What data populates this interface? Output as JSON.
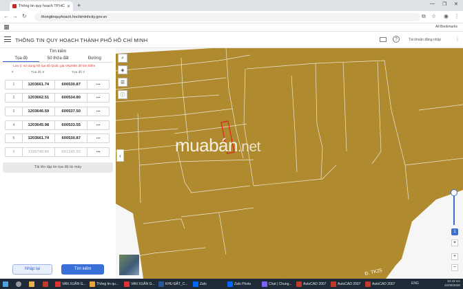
{
  "browser": {
    "tab_title": "Thông tin quy hoạch TP.HCM",
    "url": "thongtinquyhoach.hochiminhcity.gov.vn",
    "bookmarks_label": "All Bookmarks"
  },
  "header": {
    "title": "THÔNG TIN QUY HOẠCH THÀNH PHỐ HỒ CHÍ MINH",
    "login_label": "Tài khoản đăng nhập"
  },
  "panel": {
    "search_title": "Tìm kiếm",
    "tabs": [
      {
        "label": "Tọa độ"
      },
      {
        "label": "Số thửa đất"
      },
      {
        "label": "Đường"
      }
    ],
    "note": "Lưu ý: sử dụng hệ tọa độ Quốc gia VN2000 để tìm kiếm",
    "col_index": "#",
    "col_x": "Tọa độ X",
    "col_y": "Tọa độ Y",
    "rows": [
      {
        "idx": "1",
        "x": "1203661.74",
        "y": "600530.87",
        "more": "..."
      },
      {
        "idx": "2",
        "x": "1203662.51",
        "y": "600534.80",
        "more": "..."
      },
      {
        "idx": "3",
        "x": "1203646.59",
        "y": "600537.50",
        "more": "..."
      },
      {
        "idx": "4",
        "x": "1203645.98",
        "y": "600533.55",
        "more": "..."
      },
      {
        "idx": "5",
        "x": "1203661.74",
        "y": "600530.87",
        "more": "..."
      },
      {
        "idx": "6",
        "x": "1199748.84",
        "y": "651245.92",
        "more": "..."
      }
    ],
    "load_button": "Tải lên tập tin tọa độ từ máy",
    "import_button": "Nhập lại",
    "search_button": "Tìm kiếm"
  },
  "map": {
    "watermark_main": "muabán",
    "watermark_suffix": ".net",
    "road_label": "Đ. TK25",
    "zoom_level": "1",
    "parcel_fill": "#b08a2e",
    "highlight_color": "#e02020",
    "zoom_in_label": "+",
    "zoom_out_label": "−"
  },
  "taskbar": {
    "items": [
      {
        "label": "VAN XUÂN G...",
        "color": "#d33"
      },
      {
        "label": "Thông tin qu...",
        "color": "#e8a33a"
      },
      {
        "label": "VAN XUÂN G...",
        "color": "#d33"
      },
      {
        "label": "KHU ĐẤT_C...",
        "color": "#2b5797"
      },
      {
        "label": "Zalo",
        "color": "#0068ff"
      },
      {
        "label": "Zalo Photo",
        "color": "#0068ff"
      },
      {
        "label": "Chat | Chung...",
        "color": "#7b61ff"
      },
      {
        "label": "AutoCAD 2007",
        "color": "#c0392b"
      },
      {
        "label": "AutoCAD 2007",
        "color": "#c0392b"
      },
      {
        "label": "AutoCAD 2007",
        "color": "#c0392b"
      }
    ],
    "lang": "ENG",
    "time": "10:43 SA",
    "date": "22/08/2020"
  }
}
